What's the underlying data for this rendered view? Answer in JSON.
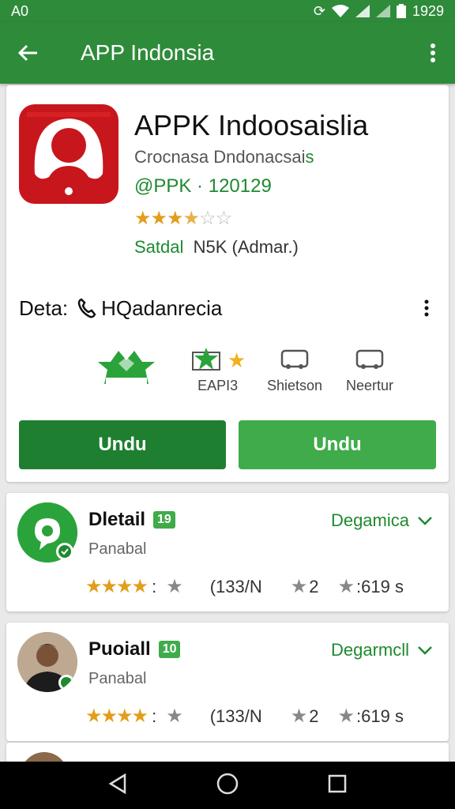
{
  "status_bar": {
    "left_text": "A0",
    "time": "1929"
  },
  "app_bar": {
    "title": "APP Indonsia"
  },
  "app": {
    "name": "APPK Indoosaislia",
    "developer_part1": "Crocnasa Dndonacsai",
    "developer_part2": "s",
    "package": "@PPK · 120129",
    "price_label": "Satdal",
    "price_detail": "N5K (Admar.)",
    "rating_stars_full": "★★★",
    "rating_stars_half": "★",
    "rating_stars_empty": "☆☆"
  },
  "detail_row": {
    "label": "Deta:",
    "value": "HQadanrecia"
  },
  "features": [
    {
      "label": ""
    },
    {
      "label": "EAPI3"
    },
    {
      "label": "Shietson"
    },
    {
      "label": "Neertur"
    }
  ],
  "buttons": {
    "primary": "Undu",
    "secondary": "Undu"
  },
  "list": [
    {
      "title": "Dletail",
      "badge": "19",
      "subtitle": "Panabal",
      "action": "Degamica",
      "stars": "★★★★",
      "sep": ":",
      "count": "(133/N",
      "m2": "2",
      "m3": ":619 s"
    },
    {
      "title": "Puoiall",
      "badge": "10",
      "subtitle": "Panabal",
      "action": "Degarmcll",
      "stars": "★★★★",
      "sep": ":",
      "count": "(133/N",
      "m2": "2",
      "m3": ":619 s"
    }
  ],
  "colors": {
    "primary_green": "#2e8b3a",
    "accent_green": "#3fab4a",
    "icon_red": "#c8161d"
  },
  "icons": [
    "back-arrow-icon",
    "more-vert-icon",
    "phone-icon",
    "crown-icon",
    "star-badge-icon",
    "car-icon",
    "chevron-down-icon"
  ]
}
